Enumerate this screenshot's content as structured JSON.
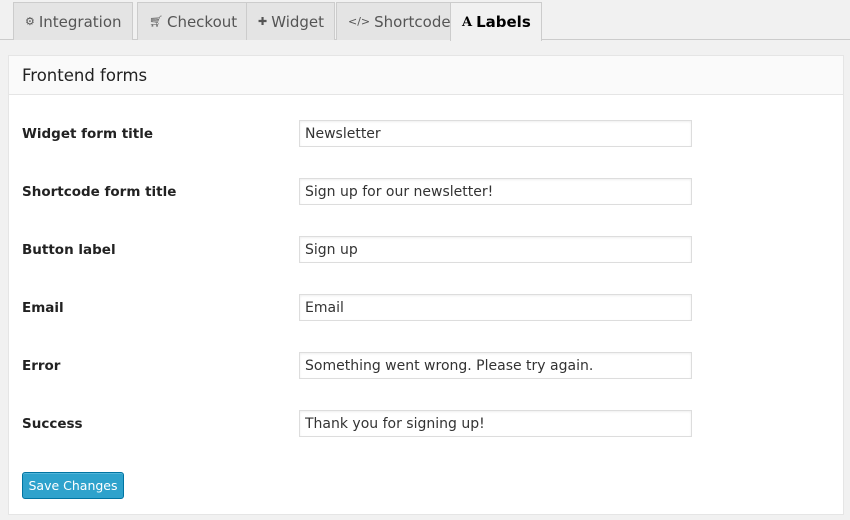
{
  "tabs": [
    {
      "label": "Integration",
      "icon": "gears-icon"
    },
    {
      "label": "Checkout",
      "icon": "cart-icon"
    },
    {
      "label": "Widget",
      "icon": "puzzle-icon"
    },
    {
      "label": "Shortcode",
      "icon": "code-icon"
    },
    {
      "label": "Labels",
      "icon": "font-icon",
      "active": true
    }
  ],
  "panel": {
    "title": "Frontend forms",
    "fields": [
      {
        "label": "Widget form title",
        "value": "Newsletter"
      },
      {
        "label": "Shortcode form title",
        "value": "Sign up for our newsletter!"
      },
      {
        "label": "Button label",
        "value": "Sign up"
      },
      {
        "label": "Email",
        "value": "Email"
      },
      {
        "label": "Error",
        "value": "Something went wrong. Please try again."
      },
      {
        "label": "Success",
        "value": "Thank you for signing up!"
      }
    ],
    "save_label": "Save Changes"
  },
  "colors": {
    "primary_button": "#2ea2cc",
    "primary_button_border": "#0074a2"
  }
}
